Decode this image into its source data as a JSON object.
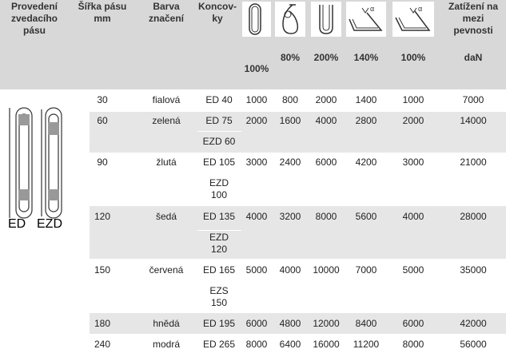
{
  "header": {
    "col1": [
      "Provedení",
      "zvedacího",
      "pásu"
    ],
    "col2": [
      "Šířka pásu",
      "mm"
    ],
    "col3": [
      "Barva",
      "značení"
    ],
    "col4": [
      "Koncov-",
      "ky"
    ],
    "col_last": [
      "Zatížení na",
      "mezi",
      "pevnosti"
    ],
    "pct": [
      "100%",
      "80%",
      "200%",
      "140%",
      "100%"
    ],
    "unit": "daN"
  },
  "icons": [
    "straight-loop-sling-icon",
    "choke-hitch-icon",
    "basket-hitch-icon",
    "angled-basket-140-icon",
    "angled-basket-100-icon"
  ],
  "side_labels": [
    "ED",
    "EZD"
  ],
  "rows": [
    {
      "width": "30",
      "color": "fialová",
      "ends": [
        "ED 40"
      ],
      "v": [
        "1000",
        "800",
        "2000",
        "1400",
        "1000"
      ],
      "load": "7000"
    },
    {
      "width": "60",
      "color": "zelená",
      "ends": [
        "ED 75",
        "EZD 60"
      ],
      "v": [
        "2000",
        "1600",
        "4000",
        "2800",
        "2000"
      ],
      "load": "14000"
    },
    {
      "width": "90",
      "color": "žlutá",
      "ends": [
        "ED 105",
        "EZD\n100"
      ],
      "v": [
        "3000",
        "2400",
        "6000",
        "4200",
        "3000"
      ],
      "load": "21000"
    },
    {
      "width": "120",
      "color": "šedá",
      "ends": [
        "ED 135",
        "EZD\n120"
      ],
      "v": [
        "4000",
        "3200",
        "8000",
        "5600",
        "4000"
      ],
      "load": "28000"
    },
    {
      "width": "150",
      "color": "červená",
      "ends": [
        "ED 165",
        "EZS\n150"
      ],
      "v": [
        "5000",
        "4000",
        "10000",
        "7000",
        "5000"
      ],
      "load": "35000"
    },
    {
      "width": "180",
      "color": "hnědá",
      "ends": [
        "ED 195"
      ],
      "v": [
        "6000",
        "4800",
        "12000",
        "8400",
        "6000"
      ],
      "load": "42000"
    },
    {
      "width": "240",
      "color": "modrá",
      "ends": [
        "ED 265"
      ],
      "v": [
        "8000",
        "6400",
        "16000",
        "11200",
        "8000"
      ],
      "load": "56000"
    }
  ]
}
